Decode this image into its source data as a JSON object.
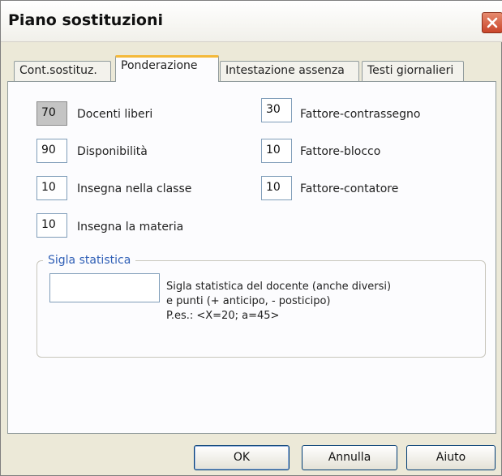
{
  "window": {
    "title": "Piano sostituzioni"
  },
  "tabs": [
    {
      "label": "Cont.sostituz.",
      "active": false
    },
    {
      "label": "Ponderazione",
      "active": true
    },
    {
      "label": "Intestazione assenza",
      "active": false
    },
    {
      "label": "Testi giornalieri",
      "active": false
    }
  ],
  "weights": {
    "left": [
      {
        "value": "70",
        "label": "Docenti liberi"
      },
      {
        "value": "90",
        "label": "Disponibilità"
      },
      {
        "value": "10",
        "label": "Insegna nella classe"
      },
      {
        "value": "10",
        "label": "Insegna la materia"
      }
    ],
    "right": [
      {
        "value": "30",
        "label": "Fattore-contrassegno"
      },
      {
        "value": "10",
        "label": "Fattore-blocco"
      },
      {
        "value": "10",
        "label": "Fattore-contatore"
      }
    ]
  },
  "statistics": {
    "legend": "Sigla statistica",
    "value": "",
    "help": [
      "Sigla statistica del docente (anche diversi)",
      "e punti (+ anticipo, - posticipo)",
      "P.es.: <X=20; a=45>"
    ]
  },
  "buttons": {
    "ok": "OK",
    "cancel": "Annulla",
    "help": "Aiuto"
  },
  "colors": {
    "accent_tab": "#f4b93a",
    "legend": "#2f5fb6",
    "close": "#c9452a"
  }
}
